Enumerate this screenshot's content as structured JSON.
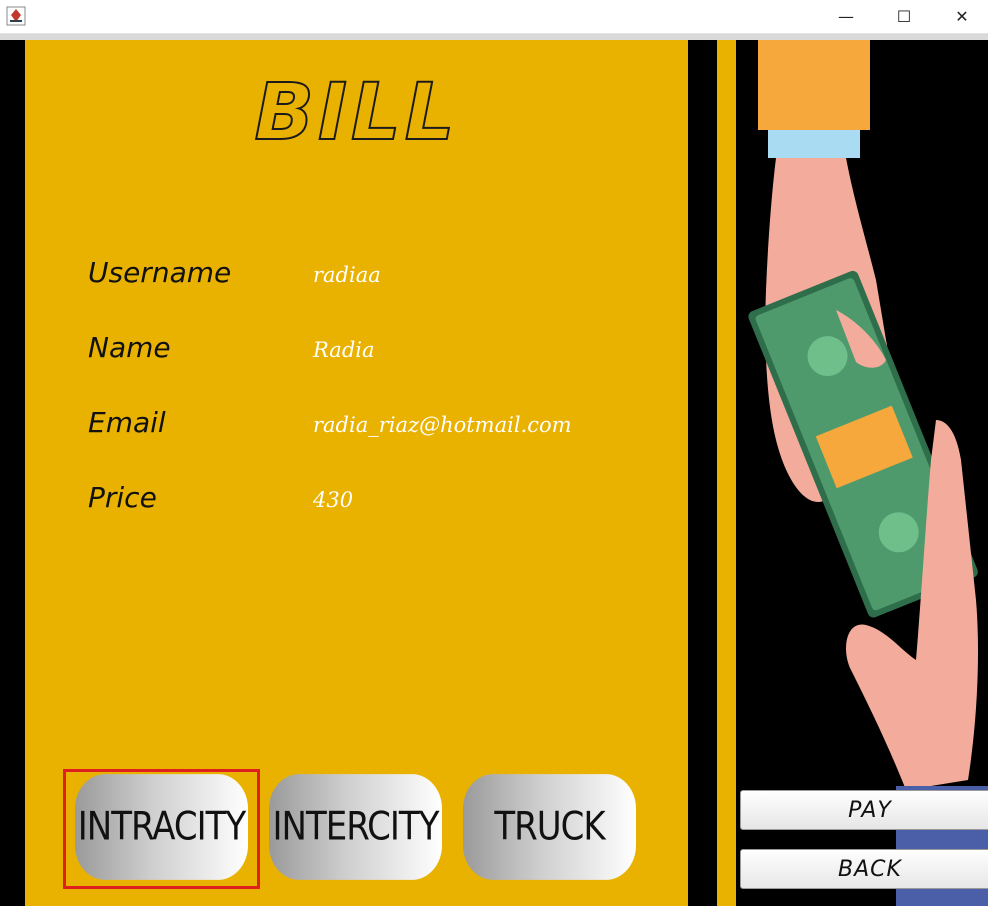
{
  "window": {
    "minimize": "—",
    "maximize": "☐",
    "close": "✕"
  },
  "bill": {
    "title": "BILL",
    "fields": [
      {
        "label": "Username",
        "value": "radiaa"
      },
      {
        "label": "Name",
        "value": "Radia"
      },
      {
        "label": "Email",
        "value": "radia_riaz@hotmail.com"
      },
      {
        "label": "Price",
        "value": "430"
      }
    ]
  },
  "ride_buttons": {
    "intracity": "INTRACITY",
    "intercity": "INTERCITY",
    "truck": "TRUCK",
    "selected": "intracity"
  },
  "actions": {
    "pay": "PAY",
    "back": "BACK"
  },
  "colors": {
    "accent": "#EAB200",
    "highlight": "#e0201e",
    "money": "#3f8f5f",
    "skin": "#f3ab9c"
  }
}
